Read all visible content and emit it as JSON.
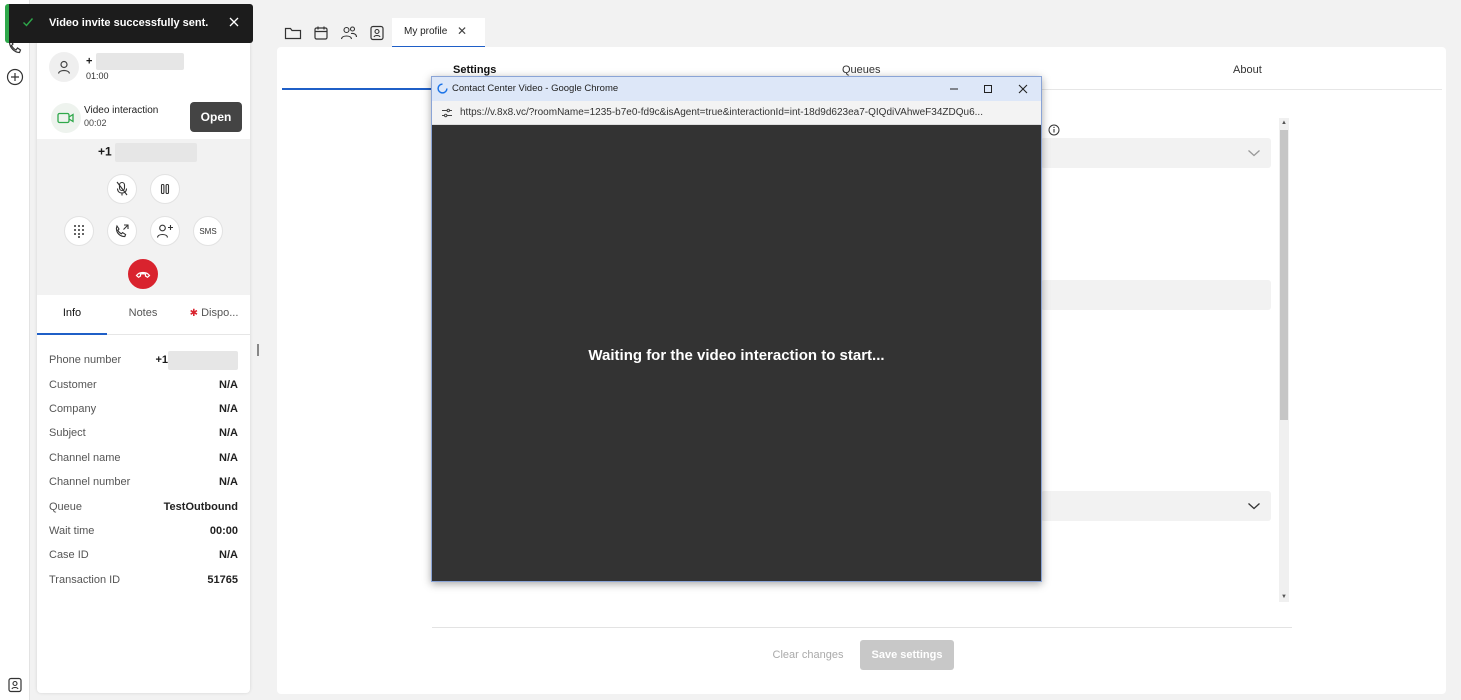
{
  "toast": {
    "message": "Video invite successfully sent."
  },
  "call": {
    "number_prefix": "+",
    "duration": "01:00",
    "video": {
      "title": "Video interaction",
      "time": "00:02",
      "open_label": "Open"
    },
    "dialed_prefix": "+1",
    "sms_label": "SMS"
  },
  "panel_tabs": [
    {
      "label": "Info"
    },
    {
      "label": "Notes"
    },
    {
      "label": "Dispo..."
    }
  ],
  "info": [
    {
      "label": "Phone number",
      "value": "+1"
    },
    {
      "label": "Customer",
      "value": "N/A"
    },
    {
      "label": "Company",
      "value": "N/A"
    },
    {
      "label": "Subject",
      "value": "N/A"
    },
    {
      "label": "Channel name",
      "value": "N/A"
    },
    {
      "label": "Channel number",
      "value": "N/A"
    },
    {
      "label": "Queue",
      "value": "TestOutbound"
    },
    {
      "label": "Wait time",
      "value": "00:00"
    },
    {
      "label": "Case ID",
      "value": "N/A"
    },
    {
      "label": "Transaction ID",
      "value": "51765"
    }
  ],
  "toolbar": {
    "profile_tab": "My profile"
  },
  "main_tabs": [
    {
      "label": "Settings"
    },
    {
      "label": "Queues"
    },
    {
      "label": "About"
    }
  ],
  "footer": {
    "clear_label": "Clear changes",
    "save_label": "Save settings"
  },
  "popup": {
    "title": "Contact Center Video - Google Chrome",
    "url": "https://v.8x8.vc/?roomName=1235-b7e0-fd9c&isAgent=true&interactionId=int-18d9d623ea7-QIQdiVAhweF34ZDQu6...",
    "waiting": "Waiting for the video interaction to start..."
  },
  "colors": {
    "accent": "#1f5fc7",
    "hangup": "#d9232e",
    "toast_success": "#2ea84a",
    "popup_bg": "#333333"
  }
}
